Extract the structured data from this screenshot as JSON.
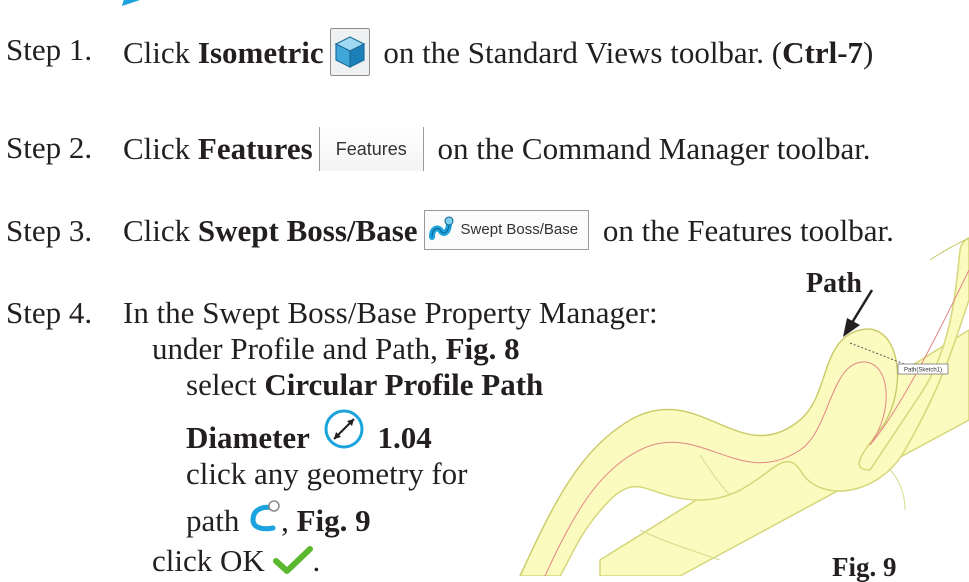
{
  "steps": [
    {
      "label": "Step 1.",
      "pre": "Click ",
      "bold": "Isometric",
      "icon": "isometric-view-icon",
      "post_a": " on the Standard Views toolbar. (",
      "shortcut": "Ctrl-7",
      "post_b": ")"
    },
    {
      "label": "Step 2.",
      "pre": "Click ",
      "bold": "Features",
      "button_text": "Features",
      "post": " on the Command Manager toolbar."
    },
    {
      "label": "Step 3.",
      "pre": "Click ",
      "bold": "Swept Boss/Base",
      "button_text": "Swept Boss/Base",
      "icon": "swept-boss-base-icon",
      "post": " on the Features toolbar."
    },
    {
      "label": "Step 4.",
      "intro": "In the Swept Boss/Base Property Manager:",
      "l2_pre": "under Profile and Path, ",
      "l2_bold": "Fig. 8",
      "l3_pre": "select ",
      "l3_bold": "Circular Profile Path",
      "l4_bold": "Diameter",
      "l4_icon": "diameter-icon",
      "l4_value": "1.04",
      "l5": "click any geometry for",
      "l6_pre": "path",
      "l6_icon": "path-selection-icon",
      "l6_mid": ", ",
      "l6_bold": "Fig. 9",
      "l7_pre": "click OK",
      "l7_icon": "ok-checkmark-icon",
      "l7_post": "."
    }
  ],
  "figure": {
    "callout": "Path",
    "tag": "Path(Sketch1)",
    "caption": "Fig. 9"
  },
  "colors": {
    "text": "#231f20",
    "accent_blue": "#1aa3dc",
    "model_fill": "#fbfbbf",
    "model_edge": "#e0e08a",
    "path_line": "#e38585",
    "check_green": "#5cb82e"
  }
}
